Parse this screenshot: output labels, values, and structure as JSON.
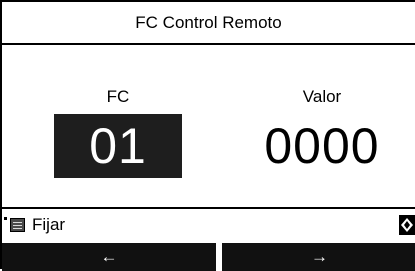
{
  "header": {
    "title": "FC Control Remoto"
  },
  "fields": {
    "fc": {
      "label": "FC",
      "value": "01"
    },
    "valor": {
      "label": "Valor",
      "value": "0000"
    }
  },
  "status": {
    "menu_icon": "menu-list-icon",
    "label": "Fijar",
    "scroll_icon": "scroll-updown-icon"
  },
  "navigation": {
    "left_arrow": "←",
    "right_arrow": "→"
  },
  "colors": {
    "background": "#ffffff",
    "text": "#000000",
    "highlight_box": "#1e1e1e",
    "button": "#111111",
    "button_text": "#ffffff"
  }
}
